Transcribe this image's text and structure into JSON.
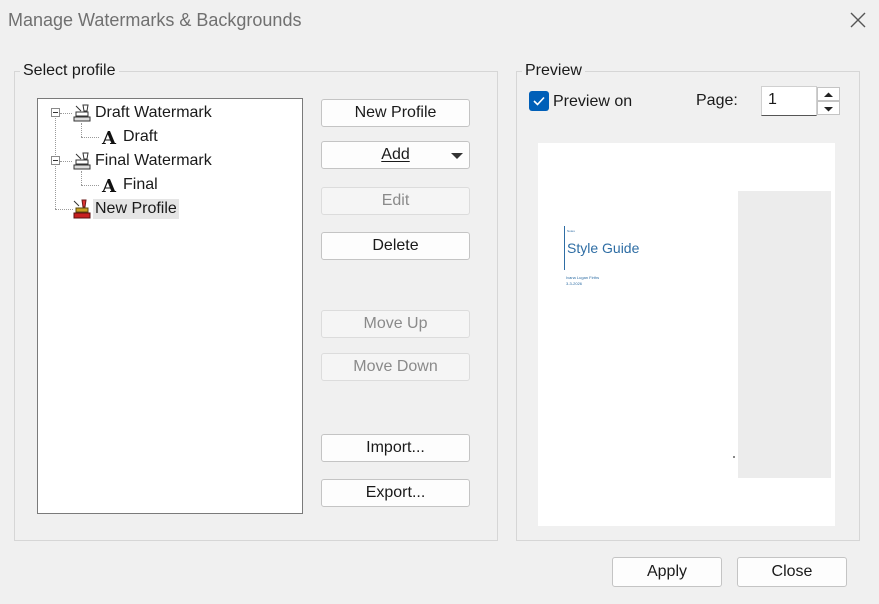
{
  "window": {
    "title": "Manage Watermarks & Backgrounds"
  },
  "select_profile": {
    "legend": "Select profile",
    "tree": [
      {
        "label": "Draft Watermark",
        "icon": "stamp-icon",
        "expanded": true
      },
      {
        "label": "Draft",
        "icon": "text-watermark-icon"
      },
      {
        "label": "Final Watermark",
        "icon": "stamp-icon",
        "expanded": true
      },
      {
        "label": "Final",
        "icon": "text-watermark-icon"
      },
      {
        "label": "New Profile",
        "icon": "new-stamp-icon",
        "selected": true
      }
    ]
  },
  "buttons": {
    "new_profile": "New Profile",
    "add": "Add",
    "edit": "Edit",
    "delete": "Delete",
    "move_up": "Move Up",
    "move_down": "Move Down",
    "import": "Import...",
    "export": "Export..."
  },
  "preview": {
    "legend": "Preview",
    "preview_on_label": "Preview on",
    "preview_on": true,
    "page_label": "Page:",
    "page_value": "1",
    "doc_small_label": "Notes",
    "doc_title": "Style Guide",
    "doc_author": "Ivana Lugan Firths",
    "doc_date": "3-3-2026"
  },
  "footer": {
    "apply": "Apply",
    "close": "Close"
  },
  "colors": {
    "accent": "#005fb8",
    "doc_title": "#2e6da4"
  }
}
